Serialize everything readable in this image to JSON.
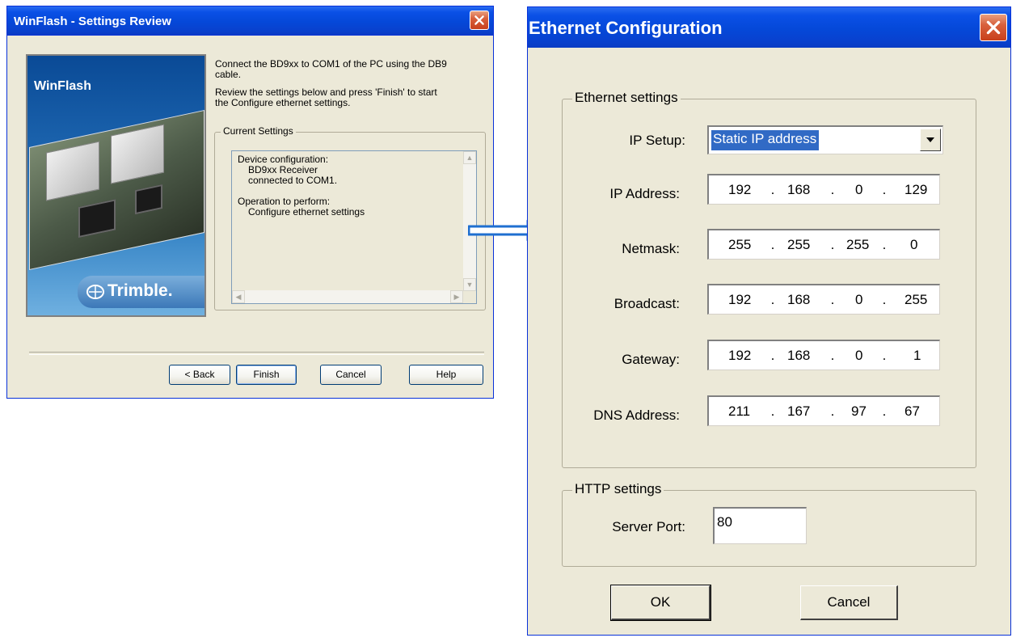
{
  "left_window": {
    "title": "WinFlash - Settings Review",
    "logo_text": "WinFlash",
    "brand_text": "Trimble.",
    "instructions": [
      "Connect the BD9xx to COM1 of the PC using the DB9",
      "cable.",
      "Review the settings below and press 'Finish' to start",
      "the Configure ethernet settings."
    ],
    "group_label": "Current Settings",
    "settings_lines": [
      "Device configuration:",
      "BD9xx Receiver",
      "connected to COM1.",
      "Operation to perform:",
      "Configure ethernet settings"
    ],
    "buttons": {
      "back": "< Back",
      "finish": "Finish",
      "cancel": "Cancel",
      "help": "Help"
    }
  },
  "right_window": {
    "title": "Ethernet Configuration",
    "ethernet_group": "Ethernet settings",
    "ip_setup": {
      "label": "IP Setup:",
      "value": "Static IP address"
    },
    "fields": [
      {
        "label": "IP Address:",
        "octets": [
          "192",
          "168",
          "0",
          "129"
        ]
      },
      {
        "label": "Netmask:",
        "octets": [
          "255",
          "255",
          "255",
          "0"
        ]
      },
      {
        "label": "Broadcast:",
        "octets": [
          "192",
          "168",
          "0",
          "255"
        ]
      },
      {
        "label": "Gateway:",
        "octets": [
          "192",
          "168",
          "0",
          "1"
        ]
      },
      {
        "label": "DNS Address:",
        "octets": [
          "211",
          "167",
          "97",
          "67"
        ]
      }
    ],
    "http_group": "HTTP settings",
    "server_port": {
      "label": "Server Port:",
      "value": "80"
    },
    "buttons": {
      "ok": "OK",
      "cancel": "Cancel"
    }
  },
  "icons": {
    "close": "close-icon",
    "arrow": "right-arrow-icon",
    "dropdown": "chevron-down-icon"
  },
  "colors": {
    "titlebar": "#0a50e6",
    "close": "#d8603c",
    "window_bg": "#ece9d8",
    "selection": "#316ac5",
    "arrow": "#1f6fd0"
  }
}
